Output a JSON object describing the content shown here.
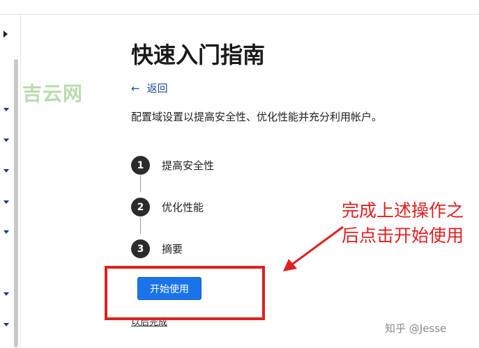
{
  "watermark": "吉云网",
  "page": {
    "title": "快速入门指南",
    "back_label": "返回",
    "description": "配置域设置以提高安全性、优化性能并充分利用帐户。"
  },
  "steps": [
    {
      "number": "1",
      "label": "提高安全性"
    },
    {
      "number": "2",
      "label": "优化性能"
    },
    {
      "number": "3",
      "label": "摘要"
    }
  ],
  "start_button_label": "开始使用",
  "later_link": "以后完成",
  "annotation": {
    "text": "完成上述操作之后点击开始使用",
    "color": "#e02020"
  },
  "credit": "知乎 @Jesse",
  "colors": {
    "accent": "#1a73e8",
    "link": "#1a4fa0",
    "annotation": "#e02020"
  }
}
